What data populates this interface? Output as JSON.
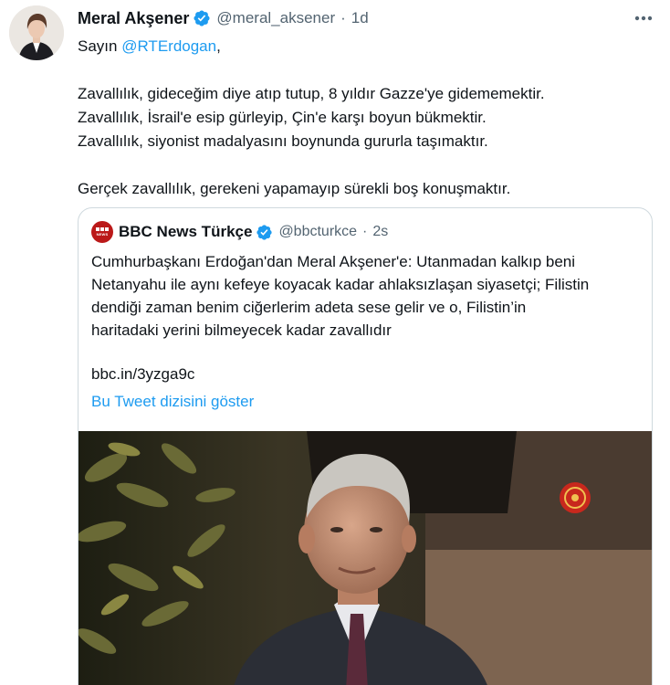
{
  "tweet": {
    "author_name": "Meral Akşener",
    "author_handle": "@meral_aksener",
    "separator": "·",
    "timestamp": "1d",
    "verified_icon": "verified-badge-icon",
    "more_icon": "more-options-icon",
    "body": {
      "greeting_prefix": "Sayın ",
      "mention": "@RTErdogan",
      "greeting_suffix": ",",
      "lines": [
        "Zavallılık, gideceğim diye atıp tutup, 8 yıldır Gazze'ye gidememektir.",
        "Zavallılık, İsrail'e esip gürleyip, Çin'e karşı boyun bükmektir.",
        "Zavallılık, siyonist madalyasını boynunda gururla taşımaktır."
      ],
      "closing": "Gerçek zavallılık, gerekeni yapamayıp sürekli boş konuşmaktır."
    },
    "quote": {
      "author_name": "BBC News Türkçe",
      "author_handle": "@bbcturkce",
      "separator": "·",
      "timestamp": "2s",
      "logo_text": "NEWS",
      "lines": [
        "Cumhurbaşkanı Erdoğan'dan Meral Akşener'e: Utanmadan kalkıp beni",
        "Netanyahu ile aynı kefeye koyacak kadar ahlaksızlaşan siyasetçi; Filistin",
        "dendiği zaman benim ciğerlerim adeta sese gelir ve o, Filistin’in",
        "haritadaki yerini bilmeyecek kadar zavallıdır"
      ],
      "link": "bbc.in/3yzga9c",
      "thread_link": "Bu Tweet dizisini göster"
    }
  },
  "colors": {
    "link_blue": "#1d9bf0",
    "secondary_text": "#536471",
    "border": "#cfd9de",
    "bbc_red": "#bb1919"
  }
}
